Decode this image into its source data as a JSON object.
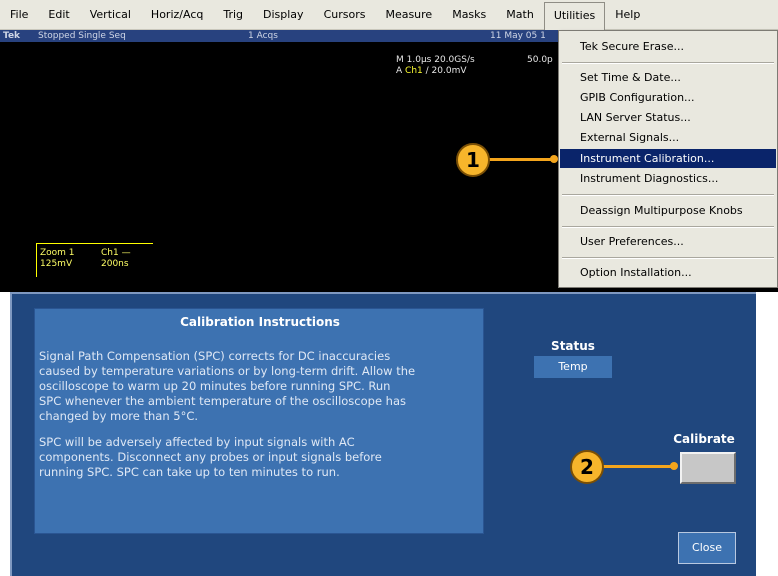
{
  "menubar": {
    "items": [
      "File",
      "Edit",
      "Vertical",
      "Horiz/Acq",
      "Trig",
      "Display",
      "Cursors",
      "Measure",
      "Masks",
      "Math",
      "Utilities",
      "Help"
    ]
  },
  "scope": {
    "brand": "Tek",
    "run_state": "Stopped Single Seq",
    "acqs": "1 Acqs",
    "date": "11 May 05 1",
    "timebase": "M 1.0µs 20.0GS/s",
    "timebase_extra": "50.0p",
    "trigger_prefix": "A",
    "trigger_channel": "Ch1",
    "trigger_level": "∕ 20.0mV",
    "zoom_label": "Zoom 1",
    "zoom_channel": "Ch1 —",
    "zoom_vertical": "125mV",
    "zoom_horizontal": "200ns"
  },
  "utilities_menu": {
    "items": [
      "Tek Secure Erase...",
      "Set Time & Date...",
      "GPIB Configuration...",
      "LAN Server Status...",
      "External Signals...",
      "Instrument Calibration...",
      "Instrument Diagnostics...",
      "Deassign Multipurpose Knobs",
      "User Preferences...",
      "Option Installation..."
    ],
    "highlighted": "Instrument Calibration..."
  },
  "calibration": {
    "title": "Calibration Instructions",
    "para1": [
      "Signal Path Compensation (SPC) corrects for DC inaccuracies",
      "caused by temperature variations or by long-term drift.  Allow the",
      "oscilloscope to warm up 20 minutes before running SPC.  Run",
      "SPC whenever the ambient temperature of the oscilloscope  has",
      "changed by more than 5°C."
    ],
    "para2": [
      "SPC will be adversely affected by input signals with AC",
      "components.  Disconnect any probes or input signals before",
      "running SPC.  SPC can take up to ten minutes to run."
    ],
    "status_label": "Status",
    "status_value": "Temp",
    "calibrate_label": "Calibrate",
    "close_label": "Close"
  },
  "callouts": {
    "one": "1",
    "two": "2"
  },
  "colors": {
    "accent_orange": "#f7b52b",
    "panel_blue": "#20477e",
    "box_blue": "#3d72b1",
    "menu_highlight": "#0a246a"
  }
}
